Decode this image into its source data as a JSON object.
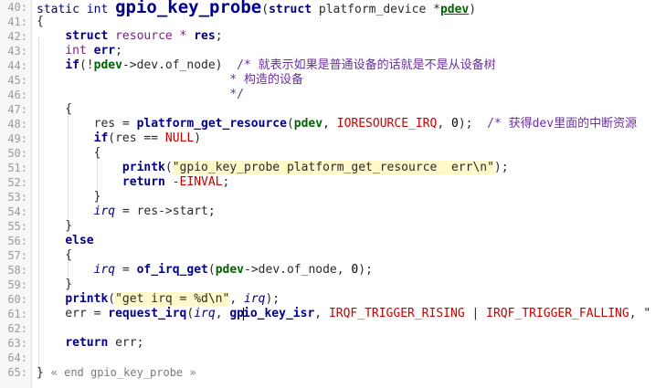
{
  "editor": {
    "lines": [
      {
        "num": "40:",
        "parts": [
          [
            "static int ",
            "kw-plain"
          ],
          [
            "gpio_key_probe",
            "fnbig"
          ],
          [
            "(",
            "p"
          ],
          [
            "struct",
            "kw"
          ],
          [
            " platform_device *",
            "p"
          ],
          [
            "pdev",
            "param-u"
          ],
          [
            ")",
            "p"
          ]
        ]
      },
      {
        "num": "41:",
        "parts": [
          [
            "{",
            "p"
          ]
        ]
      },
      {
        "num": "42:",
        "parts": [
          [
            "    ",
            "p"
          ],
          [
            "struct",
            "kw"
          ],
          [
            " resource * ",
            "ty"
          ],
          [
            "res",
            "kw"
          ],
          [
            ";",
            "p"
          ]
        ]
      },
      {
        "num": "43:",
        "parts": [
          [
            "    int ",
            "ty"
          ],
          [
            "err",
            "kw"
          ],
          [
            ";",
            "p"
          ]
        ]
      },
      {
        "num": "44:",
        "parts": [
          [
            "    ",
            "p"
          ],
          [
            "if",
            "kw"
          ],
          [
            "(!",
            "p"
          ],
          [
            "pdev",
            "param"
          ],
          [
            "->dev.of_node)  ",
            "p"
          ],
          [
            "/* 就表示如果是普通设备的话就是不是从设备树",
            "cm"
          ]
        ]
      },
      {
        "num": "45:",
        "parts": [
          [
            "                           * 构造的设备",
            "cm"
          ]
        ]
      },
      {
        "num": "46:",
        "parts": [
          [
            "                           */",
            "cm"
          ]
        ]
      },
      {
        "num": "47:",
        "parts": [
          [
            "    {",
            "p"
          ]
        ]
      },
      {
        "num": "48:",
        "parts": [
          [
            "        res = ",
            "p"
          ],
          [
            "platform_get_resource",
            "fn"
          ],
          [
            "(",
            "p"
          ],
          [
            "pdev",
            "param"
          ],
          [
            ", ",
            "p"
          ],
          [
            "IORESOURCE_IRQ",
            "macro"
          ],
          [
            ", ",
            "p"
          ],
          [
            "0",
            "num"
          ],
          [
            ");  ",
            "p"
          ],
          [
            "/* 获得dev里面的中断资源",
            "cm"
          ]
        ]
      },
      {
        "num": "49:",
        "parts": [
          [
            "        ",
            "p"
          ],
          [
            "if",
            "kw"
          ],
          [
            "(res == ",
            "p"
          ],
          [
            "NULL",
            "macro"
          ],
          [
            ")",
            "p"
          ]
        ]
      },
      {
        "num": "50:",
        "parts": [
          [
            "        {",
            "p"
          ]
        ]
      },
      {
        "num": "51:",
        "parts": [
          [
            "            ",
            "p"
          ],
          [
            "printk",
            "fn"
          ],
          [
            "(",
            "p"
          ],
          [
            "\"gpio_key_probe platform_get_resource  err\\n\"",
            "str"
          ],
          [
            ");",
            "p"
          ]
        ]
      },
      {
        "num": "52:",
        "parts": [
          [
            "            ",
            "p"
          ],
          [
            "return",
            "kw"
          ],
          [
            " -",
            "p"
          ],
          [
            "EINVAL",
            "macro"
          ],
          [
            ";",
            "p"
          ]
        ]
      },
      {
        "num": "53:",
        "parts": [
          [
            "        }",
            "p"
          ]
        ]
      },
      {
        "num": "54:",
        "parts": [
          [
            "        ",
            "p"
          ],
          [
            "irq",
            "var"
          ],
          [
            " = res->start;",
            "p"
          ]
        ]
      },
      {
        "num": "55:",
        "parts": [
          [
            "    }",
            "p"
          ]
        ]
      },
      {
        "num": "56:",
        "parts": [
          [
            "    ",
            "p"
          ],
          [
            "else",
            "kw"
          ]
        ]
      },
      {
        "num": "57:",
        "parts": [
          [
            "    {",
            "p"
          ]
        ]
      },
      {
        "num": "58:",
        "parts": [
          [
            "        ",
            "p"
          ],
          [
            "irq",
            "var"
          ],
          [
            " = ",
            "p"
          ],
          [
            "of_irq_get",
            "fn"
          ],
          [
            "(",
            "p"
          ],
          [
            "pdev",
            "param"
          ],
          [
            "->dev.of_node, ",
            "p"
          ],
          [
            "0",
            "num"
          ],
          [
            ");",
            "p"
          ]
        ]
      },
      {
        "num": "59:",
        "parts": [
          [
            "    }",
            "p"
          ]
        ]
      },
      {
        "num": "60:",
        "parts": [
          [
            "    ",
            "p"
          ],
          [
            "printk",
            "fn"
          ],
          [
            "(",
            "p"
          ],
          [
            "\"get irq = %d\\n\"",
            "str"
          ],
          [
            ", ",
            "p"
          ],
          [
            "irq",
            "var"
          ],
          [
            ");",
            "p"
          ]
        ]
      },
      {
        "num": "61:",
        "parts": [
          [
            "    err = ",
            "p"
          ],
          [
            "request_irq",
            "fn"
          ],
          [
            "(",
            "p"
          ],
          [
            "irq",
            "var"
          ],
          [
            ", ",
            "p"
          ],
          [
            "gp",
            "fn"
          ],
          [
            "CARET",
            "caret"
          ],
          [
            "io_key_isr",
            "fn"
          ],
          [
            ", ",
            "p"
          ],
          [
            "IRQF_TRIGGER_RISING",
            "macro"
          ],
          [
            " | ",
            "p"
          ],
          [
            "IRQF_TRIGGER_FALLING",
            "macro"
          ],
          [
            ", \"",
            "p"
          ]
        ]
      },
      {
        "num": "62:",
        "parts": []
      },
      {
        "num": "63:",
        "parts": [
          [
            "    ",
            "p"
          ],
          [
            "return",
            "kw"
          ],
          [
            " err;",
            "p"
          ]
        ]
      },
      {
        "num": "64:",
        "parts": []
      },
      {
        "num": "65:",
        "parts": [
          [
            "} ",
            "p"
          ],
          [
            "« end gpio_key_probe »",
            "fold"
          ]
        ]
      }
    ]
  }
}
